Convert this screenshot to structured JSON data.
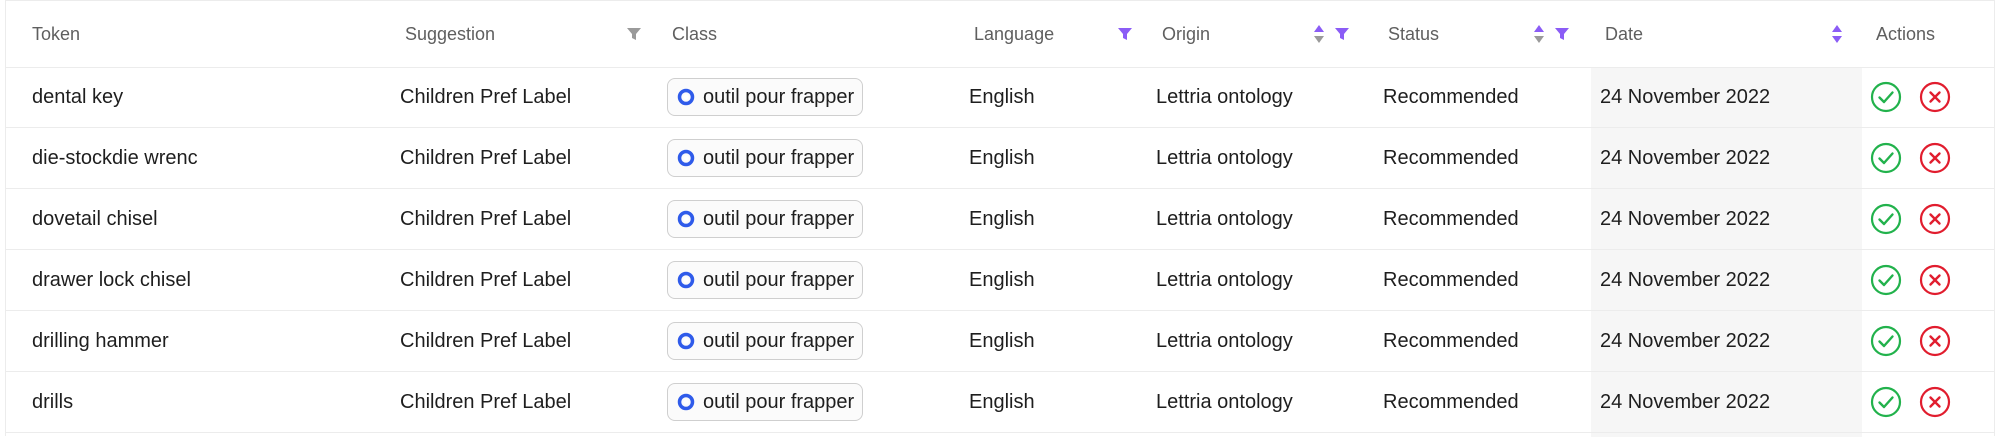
{
  "colors": {
    "accent": "#8b5cf6",
    "chip_dot": "#2f5bea",
    "accept": "#22b24c",
    "reject": "#e11d2e",
    "muted_icon": "#9a9a9a"
  },
  "header": {
    "token": "Token",
    "suggestion": "Suggestion",
    "class": "Class",
    "language": "Language",
    "origin": "Origin",
    "status": "Status",
    "date": "Date",
    "actions": "Actions"
  },
  "rows": [
    {
      "token": "dental key",
      "suggestion": "Children Pref Label",
      "class": "outil pour frapper",
      "language": "English",
      "origin": "Lettria ontology",
      "status": "Recommended",
      "date": "24 November 2022"
    },
    {
      "token": "die-stockdie wrenc",
      "suggestion": "Children Pref Label",
      "class": "outil pour frapper",
      "language": "English",
      "origin": "Lettria ontology",
      "status": "Recommended",
      "date": "24 November 2022"
    },
    {
      "token": "dovetail chisel",
      "suggestion": "Children Pref Label",
      "class": "outil pour frapper",
      "language": "English",
      "origin": "Lettria ontology",
      "status": "Recommended",
      "date": "24 November 2022"
    },
    {
      "token": "drawer lock chisel",
      "suggestion": "Children Pref Label",
      "class": "outil pour frapper",
      "language": "English",
      "origin": "Lettria ontology",
      "status": "Recommended",
      "date": "24 November 2022"
    },
    {
      "token": "drilling hammer",
      "suggestion": "Children Pref Label",
      "class": "outil pour frapper",
      "language": "English",
      "origin": "Lettria ontology",
      "status": "Recommended",
      "date": "24 November 2022"
    },
    {
      "token": "drills",
      "suggestion": "Children Pref Label",
      "class": "outil pour frapper",
      "language": "English",
      "origin": "Lettria ontology",
      "status": "Recommended",
      "date": "24 November 2022"
    }
  ],
  "icons": {
    "suggestion_filter": "filter-icon",
    "language_filter": "filter-icon",
    "origin_sort": "sort-icon",
    "origin_filter": "filter-icon",
    "status_sort": "sort-icon",
    "status_filter": "filter-icon",
    "date_sort": "sort-icon",
    "class_chip": "radio-dot-icon",
    "accept": "check-circle-icon",
    "reject": "x-circle-icon"
  }
}
